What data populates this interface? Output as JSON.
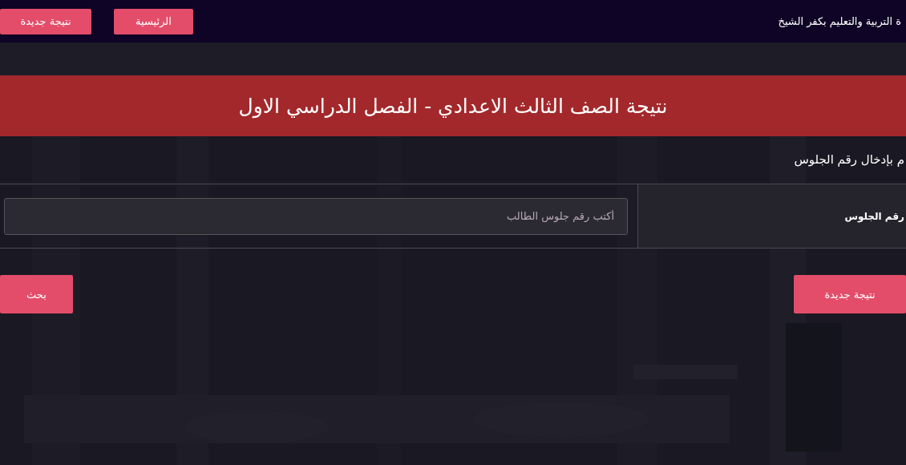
{
  "navbar": {
    "site_title": "ة التربية والتعليم بكفر الشيخ",
    "links": [
      {
        "label": "الرئيسية"
      },
      {
        "label": "نتيجة جديدة"
      }
    ]
  },
  "banner": {
    "title": "نتيجة الصف الثالث الاعدادي - الفصل الدراسي الاول"
  },
  "form": {
    "instruction": "م بإدخال رقم الجلوس",
    "field_label": "رقم الجلوس",
    "seat_field": {
      "placeholder": "أكتب رقم جلوس الطالب"
    },
    "buttons": [
      {
        "label": "نتيجة جديدة"
      },
      {
        "label": "بحث"
      }
    ]
  }
}
